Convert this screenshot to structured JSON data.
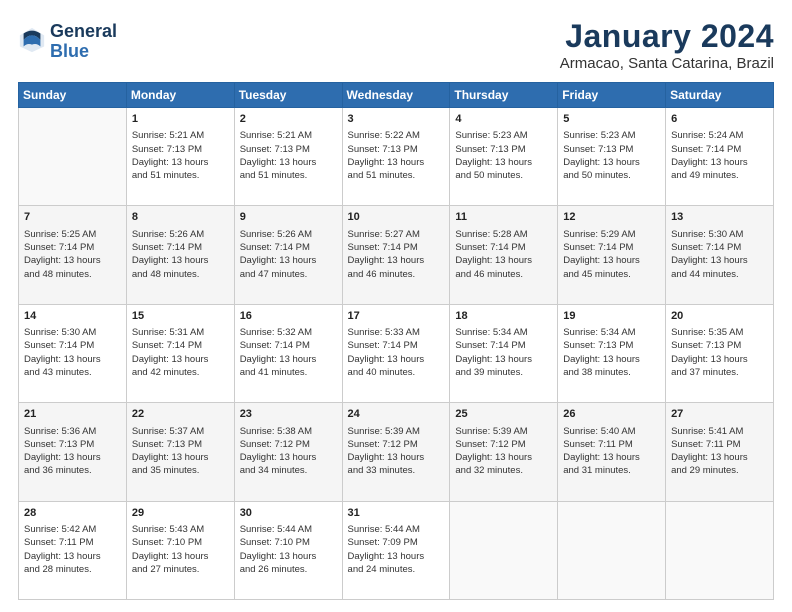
{
  "header": {
    "logo_line1": "General",
    "logo_line2": "Blue",
    "title": "January 2024",
    "subtitle": "Armacao, Santa Catarina, Brazil"
  },
  "columns": [
    "Sunday",
    "Monday",
    "Tuesday",
    "Wednesday",
    "Thursday",
    "Friday",
    "Saturday"
  ],
  "weeks": [
    [
      {
        "num": "",
        "lines": []
      },
      {
        "num": "1",
        "lines": [
          "Sunrise: 5:21 AM",
          "Sunset: 7:13 PM",
          "Daylight: 13 hours",
          "and 51 minutes."
        ]
      },
      {
        "num": "2",
        "lines": [
          "Sunrise: 5:21 AM",
          "Sunset: 7:13 PM",
          "Daylight: 13 hours",
          "and 51 minutes."
        ]
      },
      {
        "num": "3",
        "lines": [
          "Sunrise: 5:22 AM",
          "Sunset: 7:13 PM",
          "Daylight: 13 hours",
          "and 51 minutes."
        ]
      },
      {
        "num": "4",
        "lines": [
          "Sunrise: 5:23 AM",
          "Sunset: 7:13 PM",
          "Daylight: 13 hours",
          "and 50 minutes."
        ]
      },
      {
        "num": "5",
        "lines": [
          "Sunrise: 5:23 AM",
          "Sunset: 7:13 PM",
          "Daylight: 13 hours",
          "and 50 minutes."
        ]
      },
      {
        "num": "6",
        "lines": [
          "Sunrise: 5:24 AM",
          "Sunset: 7:14 PM",
          "Daylight: 13 hours",
          "and 49 minutes."
        ]
      }
    ],
    [
      {
        "num": "7",
        "lines": [
          "Sunrise: 5:25 AM",
          "Sunset: 7:14 PM",
          "Daylight: 13 hours",
          "and 48 minutes."
        ]
      },
      {
        "num": "8",
        "lines": [
          "Sunrise: 5:26 AM",
          "Sunset: 7:14 PM",
          "Daylight: 13 hours",
          "and 48 minutes."
        ]
      },
      {
        "num": "9",
        "lines": [
          "Sunrise: 5:26 AM",
          "Sunset: 7:14 PM",
          "Daylight: 13 hours",
          "and 47 minutes."
        ]
      },
      {
        "num": "10",
        "lines": [
          "Sunrise: 5:27 AM",
          "Sunset: 7:14 PM",
          "Daylight: 13 hours",
          "and 46 minutes."
        ]
      },
      {
        "num": "11",
        "lines": [
          "Sunrise: 5:28 AM",
          "Sunset: 7:14 PM",
          "Daylight: 13 hours",
          "and 46 minutes."
        ]
      },
      {
        "num": "12",
        "lines": [
          "Sunrise: 5:29 AM",
          "Sunset: 7:14 PM",
          "Daylight: 13 hours",
          "and 45 minutes."
        ]
      },
      {
        "num": "13",
        "lines": [
          "Sunrise: 5:30 AM",
          "Sunset: 7:14 PM",
          "Daylight: 13 hours",
          "and 44 minutes."
        ]
      }
    ],
    [
      {
        "num": "14",
        "lines": [
          "Sunrise: 5:30 AM",
          "Sunset: 7:14 PM",
          "Daylight: 13 hours",
          "and 43 minutes."
        ]
      },
      {
        "num": "15",
        "lines": [
          "Sunrise: 5:31 AM",
          "Sunset: 7:14 PM",
          "Daylight: 13 hours",
          "and 42 minutes."
        ]
      },
      {
        "num": "16",
        "lines": [
          "Sunrise: 5:32 AM",
          "Sunset: 7:14 PM",
          "Daylight: 13 hours",
          "and 41 minutes."
        ]
      },
      {
        "num": "17",
        "lines": [
          "Sunrise: 5:33 AM",
          "Sunset: 7:14 PM",
          "Daylight: 13 hours",
          "and 40 minutes."
        ]
      },
      {
        "num": "18",
        "lines": [
          "Sunrise: 5:34 AM",
          "Sunset: 7:14 PM",
          "Daylight: 13 hours",
          "and 39 minutes."
        ]
      },
      {
        "num": "19",
        "lines": [
          "Sunrise: 5:34 AM",
          "Sunset: 7:13 PM",
          "Daylight: 13 hours",
          "and 38 minutes."
        ]
      },
      {
        "num": "20",
        "lines": [
          "Sunrise: 5:35 AM",
          "Sunset: 7:13 PM",
          "Daylight: 13 hours",
          "and 37 minutes."
        ]
      }
    ],
    [
      {
        "num": "21",
        "lines": [
          "Sunrise: 5:36 AM",
          "Sunset: 7:13 PM",
          "Daylight: 13 hours",
          "and 36 minutes."
        ]
      },
      {
        "num": "22",
        "lines": [
          "Sunrise: 5:37 AM",
          "Sunset: 7:13 PM",
          "Daylight: 13 hours",
          "and 35 minutes."
        ]
      },
      {
        "num": "23",
        "lines": [
          "Sunrise: 5:38 AM",
          "Sunset: 7:12 PM",
          "Daylight: 13 hours",
          "and 34 minutes."
        ]
      },
      {
        "num": "24",
        "lines": [
          "Sunrise: 5:39 AM",
          "Sunset: 7:12 PM",
          "Daylight: 13 hours",
          "and 33 minutes."
        ]
      },
      {
        "num": "25",
        "lines": [
          "Sunrise: 5:39 AM",
          "Sunset: 7:12 PM",
          "Daylight: 13 hours",
          "and 32 minutes."
        ]
      },
      {
        "num": "26",
        "lines": [
          "Sunrise: 5:40 AM",
          "Sunset: 7:11 PM",
          "Daylight: 13 hours",
          "and 31 minutes."
        ]
      },
      {
        "num": "27",
        "lines": [
          "Sunrise: 5:41 AM",
          "Sunset: 7:11 PM",
          "Daylight: 13 hours",
          "and 29 minutes."
        ]
      }
    ],
    [
      {
        "num": "28",
        "lines": [
          "Sunrise: 5:42 AM",
          "Sunset: 7:11 PM",
          "Daylight: 13 hours",
          "and 28 minutes."
        ]
      },
      {
        "num": "29",
        "lines": [
          "Sunrise: 5:43 AM",
          "Sunset: 7:10 PM",
          "Daylight: 13 hours",
          "and 27 minutes."
        ]
      },
      {
        "num": "30",
        "lines": [
          "Sunrise: 5:44 AM",
          "Sunset: 7:10 PM",
          "Daylight: 13 hours",
          "and 26 minutes."
        ]
      },
      {
        "num": "31",
        "lines": [
          "Sunrise: 5:44 AM",
          "Sunset: 7:09 PM",
          "Daylight: 13 hours",
          "and 24 minutes."
        ]
      },
      {
        "num": "",
        "lines": []
      },
      {
        "num": "",
        "lines": []
      },
      {
        "num": "",
        "lines": []
      }
    ]
  ]
}
